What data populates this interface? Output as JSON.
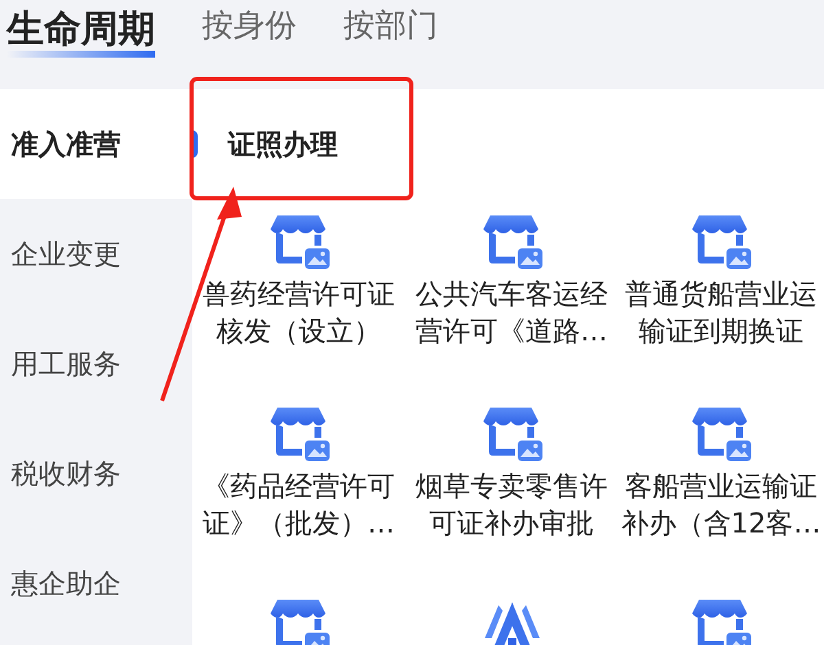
{
  "tabs": [
    {
      "label": "生命周期",
      "selected": true
    },
    {
      "label": "按身份",
      "selected": false
    },
    {
      "label": "按部门",
      "selected": false
    }
  ],
  "sidebar": {
    "items": [
      {
        "label": "准入准营",
        "selected": true
      },
      {
        "label": "企业变更",
        "selected": false
      },
      {
        "label": "用工服务",
        "selected": false
      },
      {
        "label": "税收财务",
        "selected": false
      },
      {
        "label": "惠企助企",
        "selected": false
      }
    ]
  },
  "section": {
    "title": "证照办理"
  },
  "services": [
    {
      "kind": "shop",
      "label": "兽药经营许可证核发（设立）"
    },
    {
      "kind": "shop",
      "label": "公共汽车客运经营许可《道路…"
    },
    {
      "kind": "shop",
      "label": "普通货船营业运输证到期换证"
    },
    {
      "kind": "shop",
      "label": "《药品经营许可证》（批发）…"
    },
    {
      "kind": "shop",
      "label": "烟草专卖零售许可证补办审批"
    },
    {
      "kind": "shop",
      "label": "客船营业运输证补办（含12客…"
    },
    {
      "kind": "shop"
    },
    {
      "kind": "beacon"
    },
    {
      "kind": "shop"
    }
  ]
}
